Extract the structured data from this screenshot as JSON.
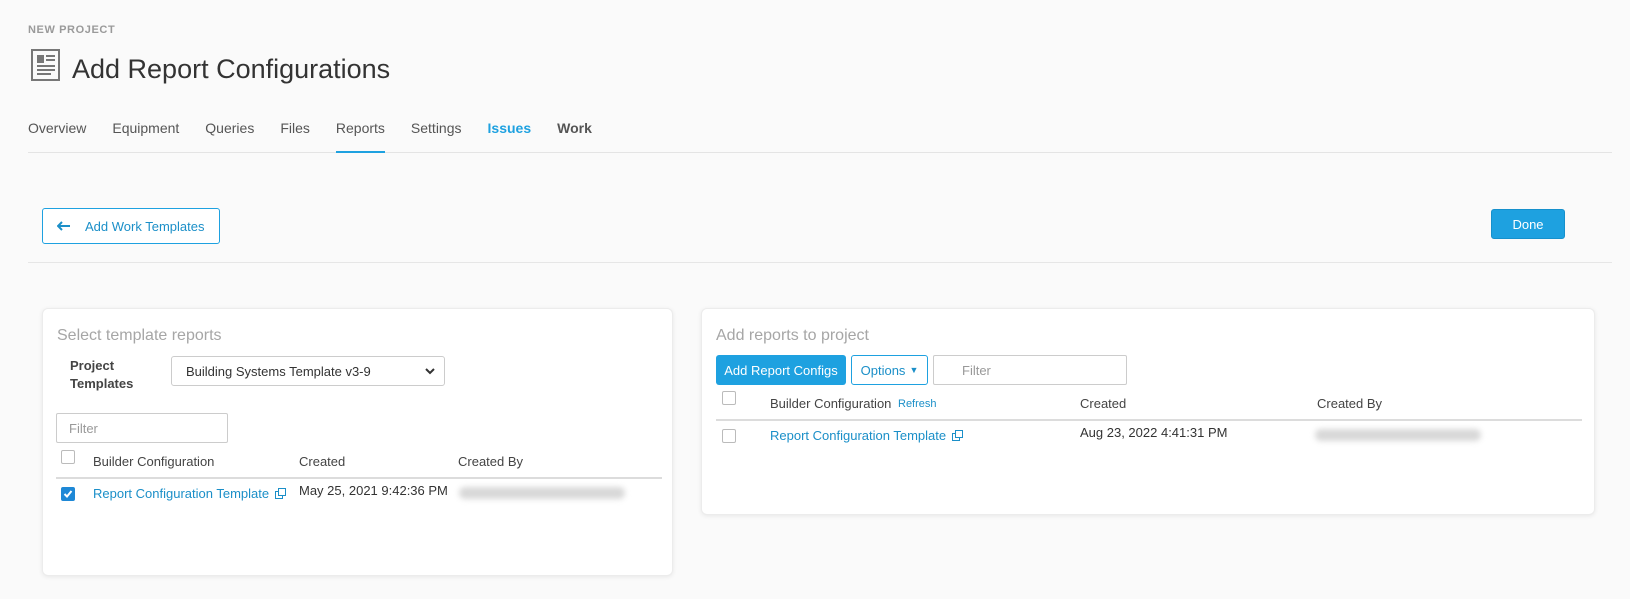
{
  "header": {
    "eyebrow": "NEW PROJECT",
    "title": "Add Report Configurations",
    "icon": "report-icon"
  },
  "tabs": [
    {
      "label": "Overview"
    },
    {
      "label": "Equipment"
    },
    {
      "label": "Queries"
    },
    {
      "label": "Files"
    },
    {
      "label": "Reports",
      "active": true
    },
    {
      "label": "Settings"
    },
    {
      "label": "Issues"
    },
    {
      "label": "Work"
    }
  ],
  "toolbar": {
    "back_label": "Add Work Templates",
    "done_label": "Done"
  },
  "colors": {
    "accent": "#1ea1e0",
    "link": "#1b8fc8"
  },
  "left_panel": {
    "title": "Select template reports",
    "project_templates_label_line1": "Project",
    "project_templates_label_line2": "Templates",
    "selected_template": "Building Systems Template v3-9",
    "filter_placeholder": "Filter",
    "columns": [
      "Builder Configuration",
      "Created",
      "Created By"
    ],
    "rows": [
      {
        "checked": true,
        "name": "Report Configuration Template",
        "created": "May 25, 2021 9:42:36 PM",
        "created_by": "emily.c.morrison@buildfirm.com"
      }
    ]
  },
  "right_panel": {
    "title": "Add reports to project",
    "add_button": "Add Report Configs",
    "options_button": "Options",
    "filter_placeholder": "Filter",
    "refresh_label": "Refresh",
    "columns": [
      "Builder Configuration",
      "Created",
      "Created By"
    ],
    "rows": [
      {
        "checked": false,
        "name": "Report Configuration Template",
        "created": "Aug 23, 2022 4:41:31 PM",
        "created_by": "emily.c.morrison@buildfirm.com"
      }
    ]
  }
}
